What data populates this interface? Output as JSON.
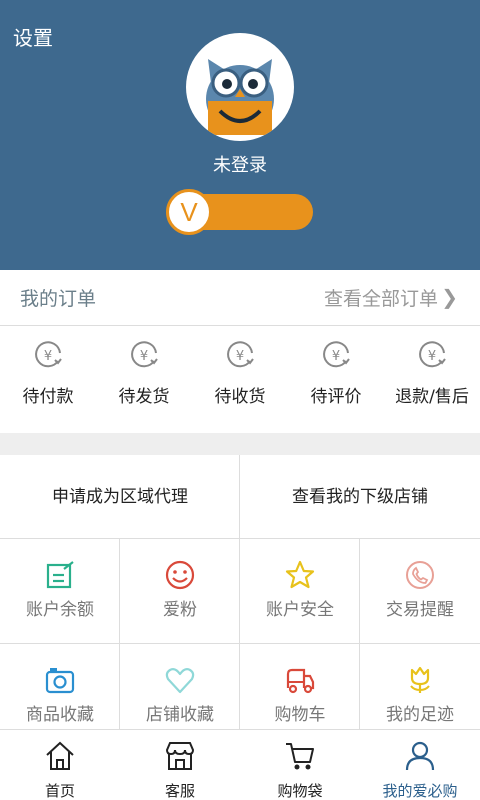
{
  "header": {
    "settings_label": "设置",
    "login_status": "未登录",
    "vip_letter": "V"
  },
  "orders": {
    "title": "我的订单",
    "view_all": "查看全部订单",
    "items": [
      {
        "label": "待付款",
        "icon": "pending-payment-icon"
      },
      {
        "label": "待发货",
        "icon": "pending-shipment-icon"
      },
      {
        "label": "待收货",
        "icon": "pending-receipt-icon"
      },
      {
        "label": "待评价",
        "icon": "pending-review-icon"
      },
      {
        "label": "退款/售后",
        "icon": "refund-icon"
      }
    ]
  },
  "agent": {
    "apply_label": "申请成为区域代理",
    "subordinate_label": "查看我的下级店铺"
  },
  "grid": {
    "items": [
      {
        "label": "账户余额",
        "icon": "balance-icon",
        "color": "#2ab08c"
      },
      {
        "label": "爱粉",
        "icon": "smile-icon",
        "color": "#d9493a"
      },
      {
        "label": "账户安全",
        "icon": "star-icon",
        "color": "#e8c21c"
      },
      {
        "label": "交易提醒",
        "icon": "phone-icon",
        "color": "#e8a096"
      },
      {
        "label": "商品收藏",
        "icon": "camera-icon",
        "color": "#2a8fd0"
      },
      {
        "label": "店铺收藏",
        "icon": "heart-icon",
        "color": "#8fd8d8"
      },
      {
        "label": "购物车",
        "icon": "truck-icon",
        "color": "#d9493a"
      },
      {
        "label": "我的足迹",
        "icon": "tulip-icon",
        "color": "#e8c21c"
      }
    ]
  },
  "tabbar": {
    "items": [
      {
        "label": "首页",
        "icon": "home-icon"
      },
      {
        "label": "客服",
        "icon": "store-icon"
      },
      {
        "label": "购物袋",
        "icon": "cart-icon"
      },
      {
        "label": "我的爱必购",
        "icon": "user-icon",
        "active": true
      }
    ]
  },
  "colors": {
    "header_bg": "#3e698e",
    "vip_orange": "#e8921c",
    "active_tab": "#2b5f8c"
  }
}
